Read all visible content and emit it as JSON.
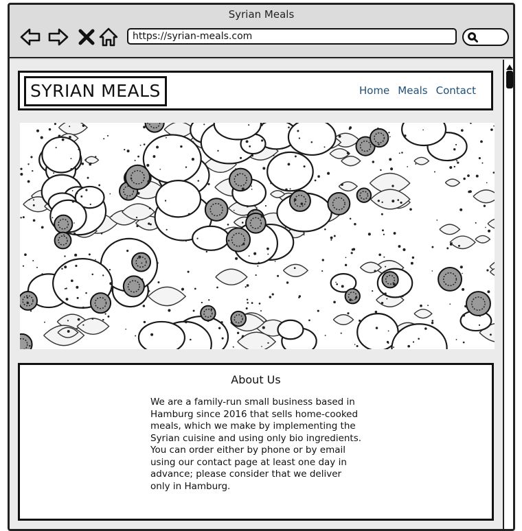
{
  "window": {
    "title": "Syrian Meals"
  },
  "browser": {
    "url": "https://syrian-meals.com",
    "icons": [
      "back-arrow-icon",
      "forward-arrow-icon",
      "close-x-icon",
      "home-icon",
      "search-icon"
    ]
  },
  "site": {
    "logo": "SYRIAN MEALS",
    "nav": [
      "Home",
      "Meals",
      "Contact"
    ],
    "nav_color": "#1f4f7a",
    "hero_image": "sketch of a sliced vegetable salad with radishes, tomatoes and parsley",
    "about": {
      "heading": "About Us",
      "body": "We are a family-run small business based in Hamburg since 2016 that sells home-cooked meals, which we make by implementing the Syrian cuisine and using only bio ingredients. You can order either by phone or by email using our contact page at least one day in advance; please consider that we deliver only in Hamburg."
    }
  }
}
